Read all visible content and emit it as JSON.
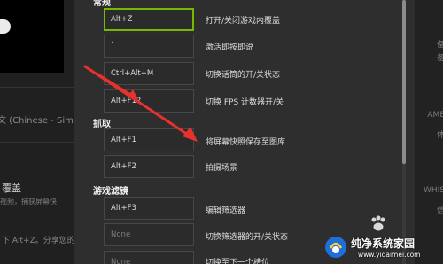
{
  "background_left": {
    "language_text": "文 (Chinese - Simp",
    "heading": "覆盖",
    "description": "视频，捕获屏幕快",
    "hint": "下 Alt+Z。分享您的"
  },
  "background_right": {
    "lines": [
      "备",
      "备",
      "AME",
      "体",
      "WHIS",
      "信"
    ]
  },
  "dialog": {
    "sections": [
      {
        "title": "常规",
        "rows": [
          {
            "key": "Alt+Z",
            "desc": "打开/关闭游戏内覆盖"
          },
          {
            "key": "`",
            "desc": "激活即按即说"
          },
          {
            "key": "Ctrl+Alt+M",
            "desc": "切换话筒的开/关状态"
          },
          {
            "key": "Alt+F12",
            "desc": "切换 FPS 计数器开/关"
          }
        ]
      },
      {
        "title": "抓取",
        "rows": [
          {
            "key": "Alt+F1",
            "desc": "将屏幕快照保存至图库"
          },
          {
            "key": "Alt+F2",
            "desc": "拍摄场景"
          }
        ]
      },
      {
        "title": "游戏滤镜",
        "rows": [
          {
            "key": "Alt+F3",
            "desc": "编辑筛选器"
          },
          {
            "key": "None",
            "desc": "切换筛选器的开/关状态"
          },
          {
            "key": "None",
            "desc": "切换至下一个槽位"
          }
        ]
      }
    ]
  },
  "watermark": {
    "title": "纯净系统家园",
    "url": "www.yidaimei.com"
  },
  "colors": {
    "accent": "#76b900",
    "annotation_arrow": "#e5322d"
  }
}
